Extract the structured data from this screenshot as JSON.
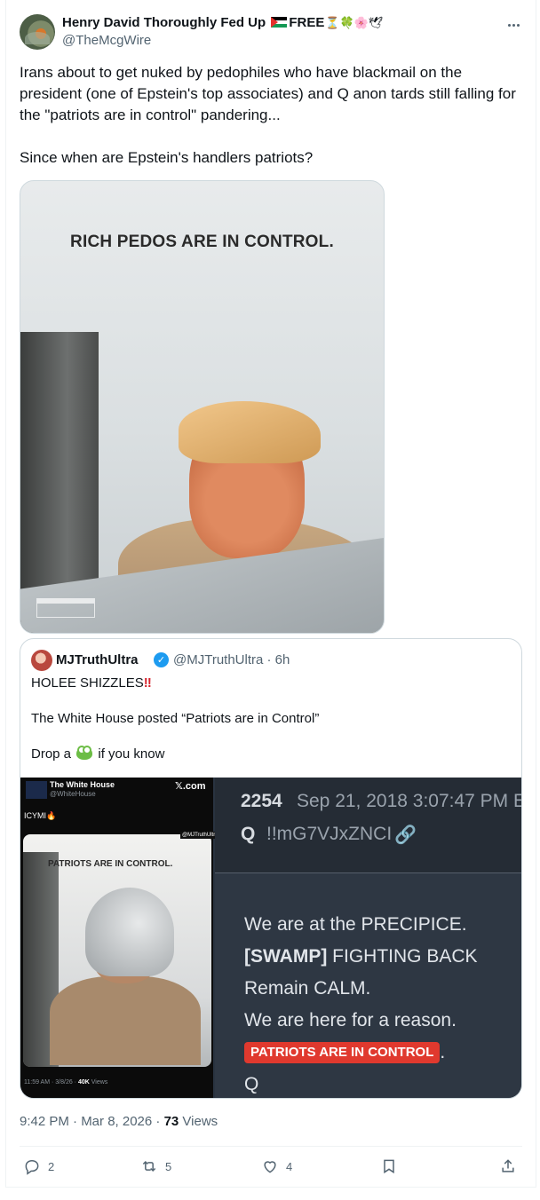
{
  "post": {
    "author_name": "Henry David Thoroughly Fed Up",
    "author_name_suffix": "FREE",
    "author_handle": "@TheMcgWire",
    "text": "Irans about to get nuked by pedophiles who have blackmail on the president (one of Epstein's top associates) and Q anon tards still falling for the \"patriots are in control\" pandering...\n\nSince when are Epstein's handlers patriots?",
    "image_caption": "RICH PEDOS ARE IN CONTROL.",
    "timestamp": "9:42 PM · Mar 8, 2026 · ",
    "views_count": "73",
    "views_label": " Views"
  },
  "quoted": {
    "author_name": "MJTruthUltra",
    "author_handle_time": "@MJTruthUltra · 6h",
    "line1": "HOLEE SHIZZLES",
    "line1_mark": "‼",
    "line2": "The White House posted “Patriots are in Control”",
    "line3_pre": "Drop a ",
    "line3_post": " if you know",
    "media": {
      "wh_name": "The White House",
      "wh_handle": "@WhiteHouse",
      "xcom": "𝕏.com",
      "icymi": "ICYMI🔥",
      "watermark": "@MJTruthUltra",
      "photo_caption": "PATRIOTS ARE IN CONTROL.",
      "meta_time": "11:59 AM · 3/8/26 · ",
      "meta_views": "40K",
      "meta_views_label": " Views",
      "drop_number": "2254",
      "drop_date": "Sep 21, 2018 3:07:47 PM E",
      "drop_q": "Q",
      "drop_trip": "!!mG7VJxZNCI",
      "drop_line1": "We are at the PRECIPICE.",
      "drop_line2_bold": "[SWAMP]",
      "drop_line2_rest": " FIGHTING BACK",
      "drop_line3": "Remain CALM.",
      "drop_line4": "We are here for a reason.",
      "drop_tag": "PATRIOTS ARE IN CONTROL",
      "drop_tag_after": ".",
      "drop_sign": "Q"
    }
  },
  "actions": {
    "replies": "2",
    "reposts": "5",
    "likes": "4"
  },
  "icons": [
    "more-icon",
    "verified-icon",
    "link-icon",
    "reply-icon",
    "repost-icon",
    "like-icon",
    "bookmark-icon",
    "share-icon"
  ],
  "colors": {
    "accent": "#1d9bf0",
    "text": "#0f1419",
    "muted": "#536471",
    "tag_red": "#e0392e"
  }
}
